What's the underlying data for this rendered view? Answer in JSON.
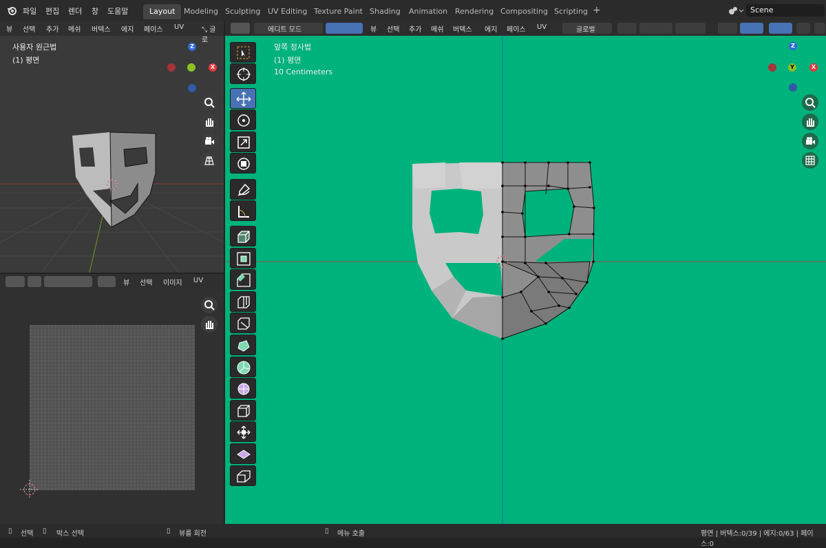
{
  "topbar": {
    "menus": [
      "파일",
      "편집",
      "렌더",
      "창",
      "도움말"
    ],
    "tabs": [
      "Layout",
      "Modeling",
      "Sculpting",
      "UV Editing",
      "Texture Paint",
      "Shading",
      "Animation",
      "Rendering",
      "Compositing",
      "Scripting"
    ],
    "add_tab": "+",
    "scene": "Scene"
  },
  "left_viewport": {
    "menus": [
      "뷰",
      "선택",
      "추가",
      "메쉬",
      "버텍스",
      "에지",
      "페이스",
      "UV"
    ],
    "clipped_label": "글로",
    "view_name": "사용자 원근법",
    "object": "(1) 평면",
    "axis": {
      "z": "Z",
      "x": "X"
    }
  },
  "uv_editor": {
    "menus": [
      "뷰",
      "선택",
      "이미지",
      "UV"
    ]
  },
  "main_viewport": {
    "mode": "에디트 모드",
    "menus": [
      "뷰",
      "선택",
      "추가",
      "메쉬",
      "버텍스",
      "에지",
      "페이스",
      "UV"
    ],
    "transform": "글로벌",
    "view_name": "앞쪽 정사법",
    "object": "(1) 평면",
    "scale": "10 Centimeters",
    "axis": {
      "z": "Z",
      "y": "Y",
      "x": "X"
    },
    "bg_color": "#00b27c"
  },
  "status": {
    "select": "선택",
    "box_select": "박스 선택",
    "rotate": "뷰를 회전",
    "menu": "메뉴 호출",
    "stats": "평면 | 버텍스:0/39 | 에지:0/63 | 페이스:0"
  },
  "icons": [
    "blender-logo-icon",
    "select-box-icon",
    "cursor-icon",
    "move-icon",
    "rotate-icon",
    "scale-icon",
    "transform-icon",
    "annotate-icon",
    "measure-icon",
    "extrude-icon",
    "inset-icon",
    "bevel-icon",
    "loop-cut-icon",
    "knife-icon",
    "poly-build-icon",
    "spin-icon",
    "smooth-icon",
    "edge-slide-icon",
    "shrink-icon",
    "shear-icon",
    "rip-icon",
    "zoom-icon",
    "hand-icon",
    "camera-icon",
    "grid-icon"
  ]
}
